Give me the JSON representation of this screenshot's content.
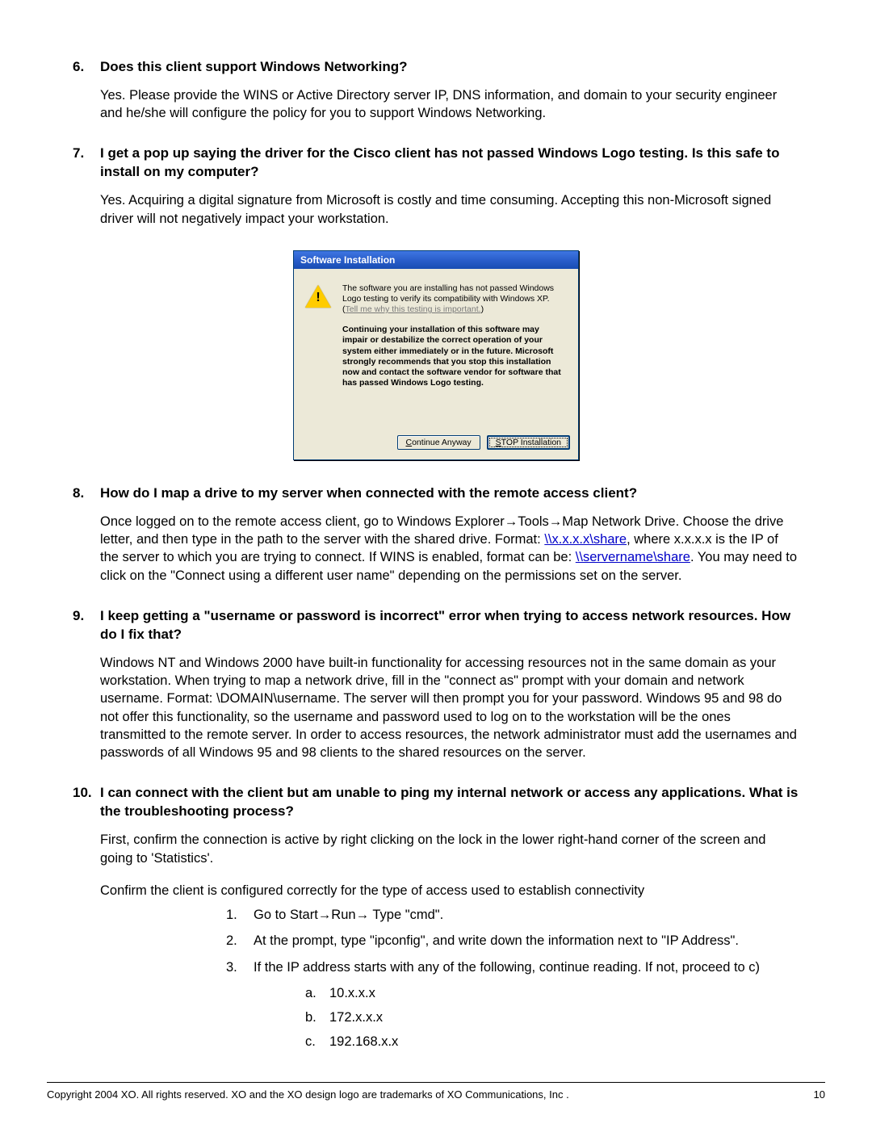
{
  "items": [
    {
      "num": "6.",
      "q": "Does this client support Windows Networking?",
      "a": "Yes. Please provide the WINS or Active Directory server IP, DNS information, and domain to your security engineer and he/she will configure the policy for you to support Windows Networking."
    },
    {
      "num": "7.",
      "q": "I get a pop up saying the driver for the Cisco client has not passed Windows Logo testing. Is this safe to install on my computer?",
      "a": "Yes. Acquiring a digital signature from Microsoft is costly and time consuming. Accepting this non-Microsoft signed driver will not negatively impact your workstation."
    },
    {
      "num": "8.",
      "q": "How do I map a drive to my server when connected with the remote access client?",
      "a_pre": "Once logged on to the remote access client, go to Windows Explorer",
      "a_mid1": "Tools",
      "a_mid2": "Map Network Drive. Choose the drive letter, and then type in the path to the server with the shared drive. Format: ",
      "link1": "\\\\x.x.x.x\\share",
      "a_mid3": ", where x.x.x.x is the IP of the server to which you are trying to connect. If WINS is enabled, format can be: ",
      "link2": "\\\\servername\\share",
      "a_post": ". You may need to click on the \"Connect using a different user name\" depending on the permissions set on the server."
    },
    {
      "num": "9.",
      "q": "I keep getting a \"username or password is incorrect\" error when trying to access network resources. How do I fix that?",
      "a": "Windows NT and Windows 2000 have built-in functionality for accessing resources not in the same domain as your workstation. When trying to map a network drive, fill in the \"connect as\" prompt with your domain and network username. Format: \\DOMAIN\\username. The server will then prompt you for your password. Windows 95 and 98 do not offer this functionality, so the username and password used to log on to the workstation will be the ones transmitted to the remote server. In order to access resources, the network administrator must add the usernames and passwords of all Windows 95 and 98 clients to the shared resources on the server."
    },
    {
      "num": "10.",
      "q_pre": "I can connect with the client but am unable to ping my internal network or access any applications.",
      "q_post": " What is the troubleshooting process?",
      "a1": "First, confirm the connection is active by right clicking on the lock in the lower right-hand corner of the screen and going to 'Statistics'.",
      "a2": "Confirm the client is configured correctly for the type of access used to establish connectivity",
      "steps": [
        {
          "lbl": "1.",
          "pre": "Go to Start",
          "mid": "Run",
          "post": " Type \"cmd\"."
        },
        {
          "lbl": "2.",
          "txt": "At the prompt, type \"ipconfig\", and write down the information next to \"IP Address\"."
        },
        {
          "lbl": "3.",
          "txt": "If the IP address starts with any of the following, continue reading. If not, proceed to c)"
        }
      ],
      "letters": [
        {
          "lbl": "a.",
          "txt": "10.x.x.x"
        },
        {
          "lbl": "b.",
          "txt": "172.x.x.x"
        },
        {
          "lbl": "c.",
          "txt": "192.168.x.x"
        }
      ]
    }
  ],
  "dialog": {
    "title": "Software Installation",
    "p1a": "The software you are installing has not passed Windows Logo testing to verify its compatibility with Windows XP. (",
    "tell": "Tell me why this testing is important.",
    "p1b": ")",
    "p2": "Continuing your installation of this software may impair or destabilize the correct operation of your system either immediately or in the future. Microsoft strongly recommends that you stop this installation now and contact the software vendor for software that has passed Windows Logo testing.",
    "btn_continue_m": "C",
    "btn_continue_r": "ontinue Anyway",
    "btn_stop_m": "S",
    "btn_stop_r": "TOP Installation"
  },
  "footer": {
    "left": "Copyright 2004 XO. All rights reserved. XO and the XO design logo are trademarks of XO Communications, Inc .",
    "right": "10"
  },
  "glyphs": {
    "arrow": "→"
  }
}
